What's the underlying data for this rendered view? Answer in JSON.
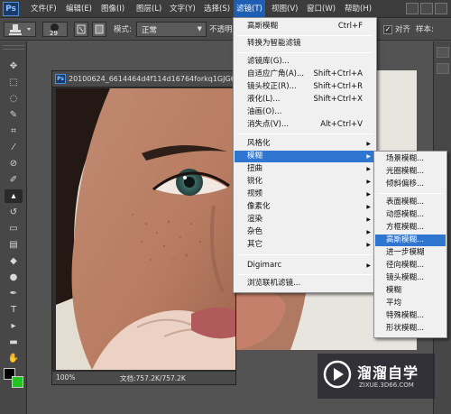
{
  "menubar": {
    "logo": "Ps",
    "items": [
      {
        "label": "文件(F)"
      },
      {
        "label": "编辑(E)"
      },
      {
        "label": "图像(I)"
      },
      {
        "label": "图层(L)"
      },
      {
        "label": "文字(Y)"
      },
      {
        "label": "选择(S)"
      },
      {
        "label": "滤镜(T)"
      },
      {
        "label": "视图(V)"
      },
      {
        "label": "窗口(W)"
      },
      {
        "label": "帮助(H)"
      }
    ]
  },
  "options": {
    "brush_size": "29",
    "mode_label": "模式:",
    "mode_value": "正常",
    "opacity_label": "不透明",
    "align_label": "对齐",
    "sample_label": "样本:"
  },
  "document": {
    "title": "20100624_6614464d4f114d16764forkq1GJG6C0",
    "zoom": "100%",
    "info": "文档:757.2K/757.2K"
  },
  "filter_menu": {
    "items": [
      {
        "label": "高斯模糊",
        "shortcut": "Ctrl+F"
      },
      {
        "label": "转换为智能滤镜"
      },
      {
        "label": "滤镜库(G)..."
      },
      {
        "label": "自适应广角(A)...",
        "shortcut": "Shift+Ctrl+A"
      },
      {
        "label": "镜头校正(R)...",
        "shortcut": "Shift+Ctrl+R"
      },
      {
        "label": "液化(L)...",
        "shortcut": "Shift+Ctrl+X"
      },
      {
        "label": "油画(O)..."
      },
      {
        "label": "消失点(V)...",
        "shortcut": "Alt+Ctrl+V"
      },
      {
        "label": "风格化"
      },
      {
        "label": "模糊"
      },
      {
        "label": "扭曲"
      },
      {
        "label": "锐化"
      },
      {
        "label": "视频"
      },
      {
        "label": "像素化"
      },
      {
        "label": "渲染"
      },
      {
        "label": "杂色"
      },
      {
        "label": "其它"
      },
      {
        "label": "Digimarc"
      },
      {
        "label": "浏览联机滤镜..."
      }
    ]
  },
  "blur_submenu": {
    "items": [
      {
        "label": "场景模糊..."
      },
      {
        "label": "光圈模糊..."
      },
      {
        "label": "倾斜偏移..."
      },
      {
        "label": "表面模糊..."
      },
      {
        "label": "动感模糊..."
      },
      {
        "label": "方框模糊..."
      },
      {
        "label": "高斯模糊..."
      },
      {
        "label": "进一步模糊"
      },
      {
        "label": "径向模糊..."
      },
      {
        "label": "镜头模糊..."
      },
      {
        "label": "模糊"
      },
      {
        "label": "平均"
      },
      {
        "label": "特殊模糊..."
      },
      {
        "label": "形状模糊..."
      }
    ]
  },
  "watermark": {
    "name": "溜溜自学",
    "url": "ZIXUE.3D66.COM"
  },
  "colors": {
    "highlight": "#2f76d0",
    "foreground": "#000000",
    "background": "#22c322"
  }
}
